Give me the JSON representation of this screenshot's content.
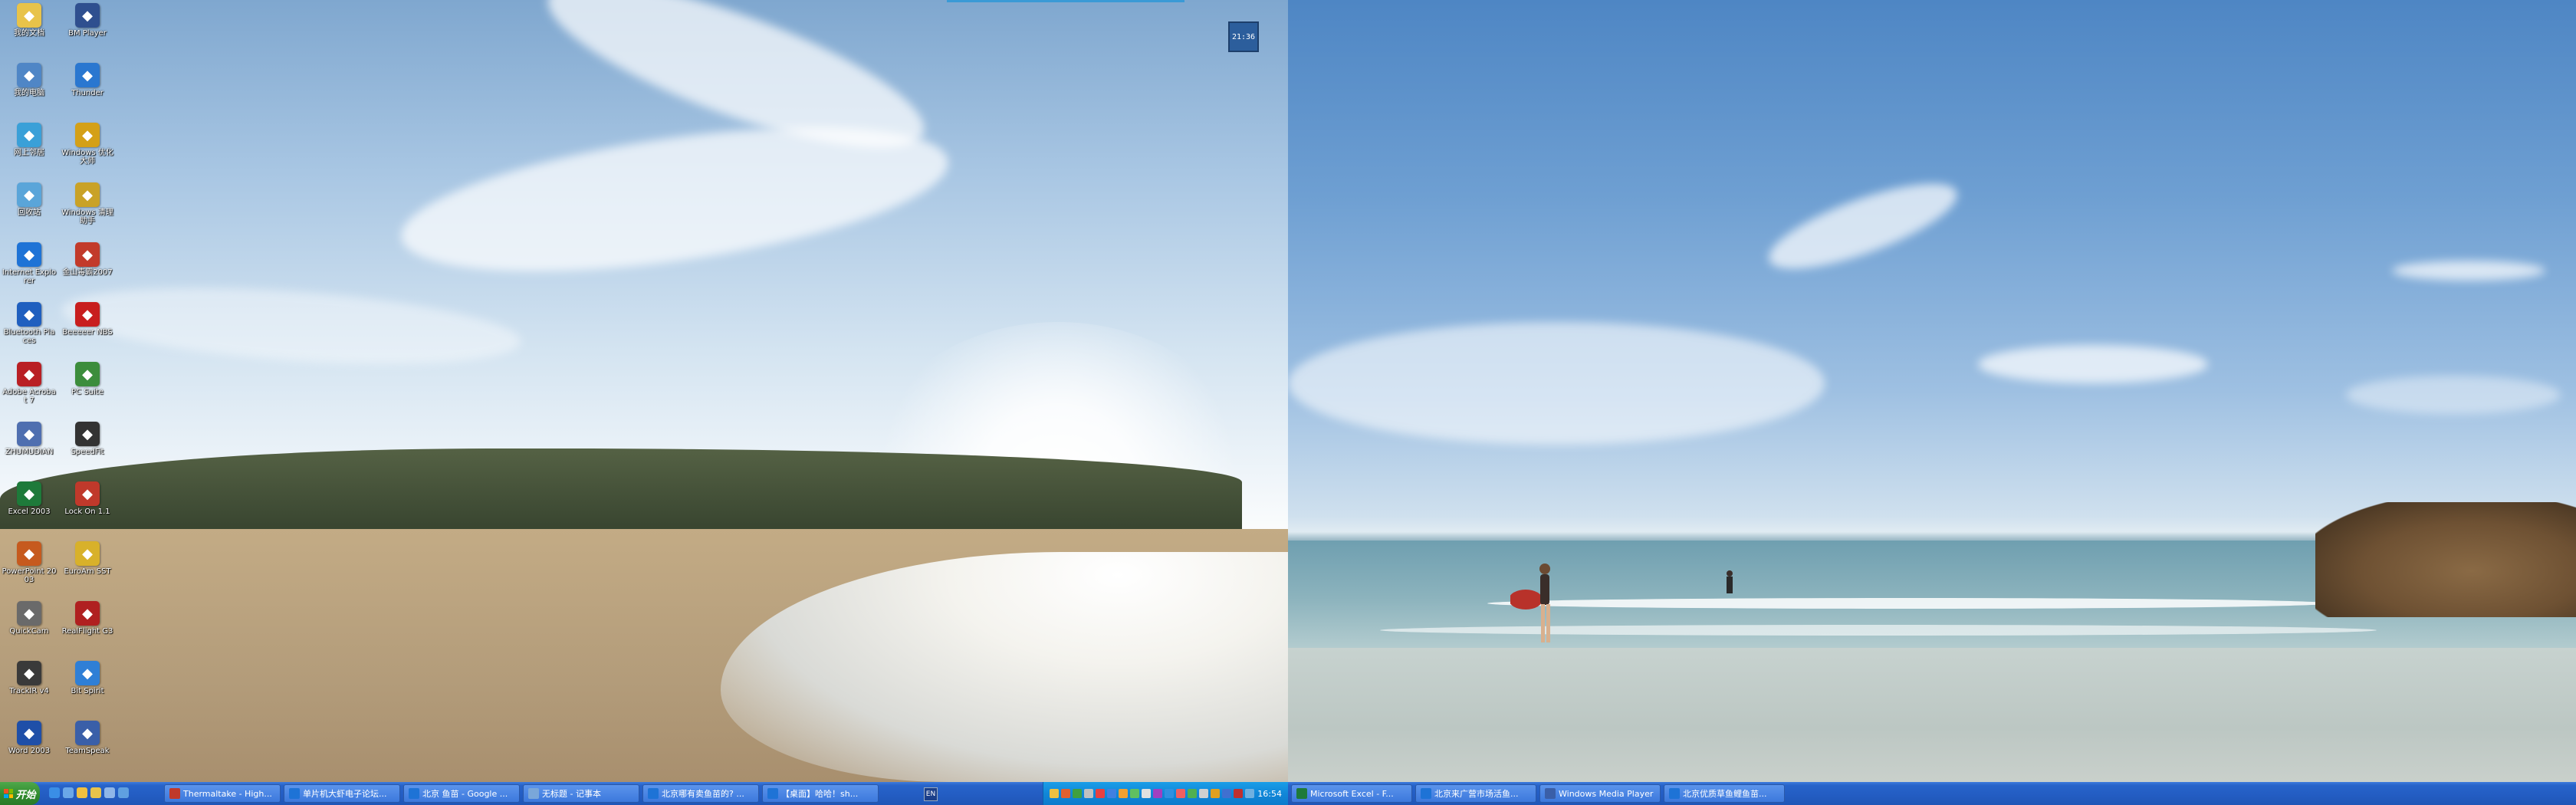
{
  "desktop": {
    "icons": [
      {
        "label": "我的文档",
        "icon": "folder-icon",
        "color": "#e8c34a"
      },
      {
        "label": "BM Player",
        "icon": "media-player-icon",
        "color": "#2f4f8f"
      },
      {
        "label": "我的电脑",
        "icon": "computer-icon",
        "color": "#4f86c6"
      },
      {
        "label": "Thunder",
        "icon": "thunder-icon",
        "color": "#2a77d0"
      },
      {
        "label": "网上邻居",
        "icon": "network-icon",
        "color": "#3aa0d8"
      },
      {
        "label": "Windows 优化大师",
        "icon": "optimizer-icon",
        "color": "#d4a017"
      },
      {
        "label": "回收站",
        "icon": "recycle-bin-icon",
        "color": "#5aa5d9"
      },
      {
        "label": "Windows 清理助手",
        "icon": "cleaner-icon",
        "color": "#c9a227"
      },
      {
        "label": "Internet Explorer",
        "icon": "ie-icon",
        "color": "#1e73d6"
      },
      {
        "label": "金山毒霸2007",
        "icon": "antivirus-icon",
        "color": "#c23a2a"
      },
      {
        "label": "Bluetooth Places",
        "icon": "bluetooth-icon",
        "color": "#1f5fbf"
      },
      {
        "label": "Beeeeer NBS",
        "icon": "disc-burner-icon",
        "color": "#c81e1e"
      },
      {
        "label": "Adobe Acrobat 7",
        "icon": "acrobat-icon",
        "color": "#b91f24"
      },
      {
        "label": "PC Suite",
        "icon": "pc-suite-icon",
        "color": "#3c8d3c"
      },
      {
        "label": "ZHUMUDIAN",
        "icon": "globe-icon",
        "color": "#4f6fb0"
      },
      {
        "label": "SpeedFit",
        "icon": "speed-icon",
        "color": "#333333"
      },
      {
        "label": "Excel 2003",
        "icon": "excel-icon",
        "color": "#1e7a3a"
      },
      {
        "label": "Lock On 1.1",
        "icon": "lock-on-icon",
        "color": "#c0392b"
      },
      {
        "label": "PowerPoint 2003",
        "icon": "powerpoint-icon",
        "color": "#c65a1e"
      },
      {
        "label": "EuroAm SST",
        "icon": "simulator-icon",
        "color": "#d8b12a"
      },
      {
        "label": "QuickCam",
        "icon": "webcam-icon",
        "color": "#6a6a6a"
      },
      {
        "label": "RealFlight G3",
        "icon": "realflight-icon",
        "color": "#b02020"
      },
      {
        "label": "TrackIR v4",
        "icon": "trackir-icon",
        "color": "#3a3a3a"
      },
      {
        "label": "Bit Spirit",
        "icon": "bitspirit-icon",
        "color": "#2f7fd6"
      },
      {
        "label": "Word 2003",
        "icon": "word-icon",
        "color": "#1f4fa8"
      },
      {
        "label": "TeamSpeak",
        "icon": "teamspeak-icon",
        "color": "#3a5fa8"
      }
    ],
    "clock_widget": "21:36"
  },
  "taskbar": {
    "start_label": "开始",
    "quick_launch": [
      "ie-icon",
      "media-icon",
      "desktop-icon",
      "folder-icon",
      "window-icon",
      "app-icon"
    ],
    "left_tasks": [
      {
        "label": "Thermaltake - High...",
        "color": "#c0392b"
      },
      {
        "label": "单片机大虾电子论坛...",
        "color": "#1e73d6"
      },
      {
        "label": "北京 鱼苗 - Google ...",
        "color": "#1e73d6"
      },
      {
        "label": "无标题 - 记事本",
        "color": "#7aa7d9"
      },
      {
        "label": "北京哪有卖鱼苗的? ...",
        "color": "#1e73d6"
      },
      {
        "label": "【桌面】哈哈！sh...",
        "color": "#1e73d6"
      }
    ],
    "language_indicator": "EN",
    "clock": "16:54",
    "right_tasks": [
      {
        "label": "Microsoft Excel - F...",
        "color": "#1e7a3a"
      },
      {
        "label": "北京来广营市场活鱼...",
        "color": "#1e73d6"
      },
      {
        "label": "Windows Media Player",
        "color": "#3a5fa8"
      },
      {
        "label": "北京优质草鱼鲤鱼苗...",
        "color": "#1e73d6"
      }
    ]
  }
}
